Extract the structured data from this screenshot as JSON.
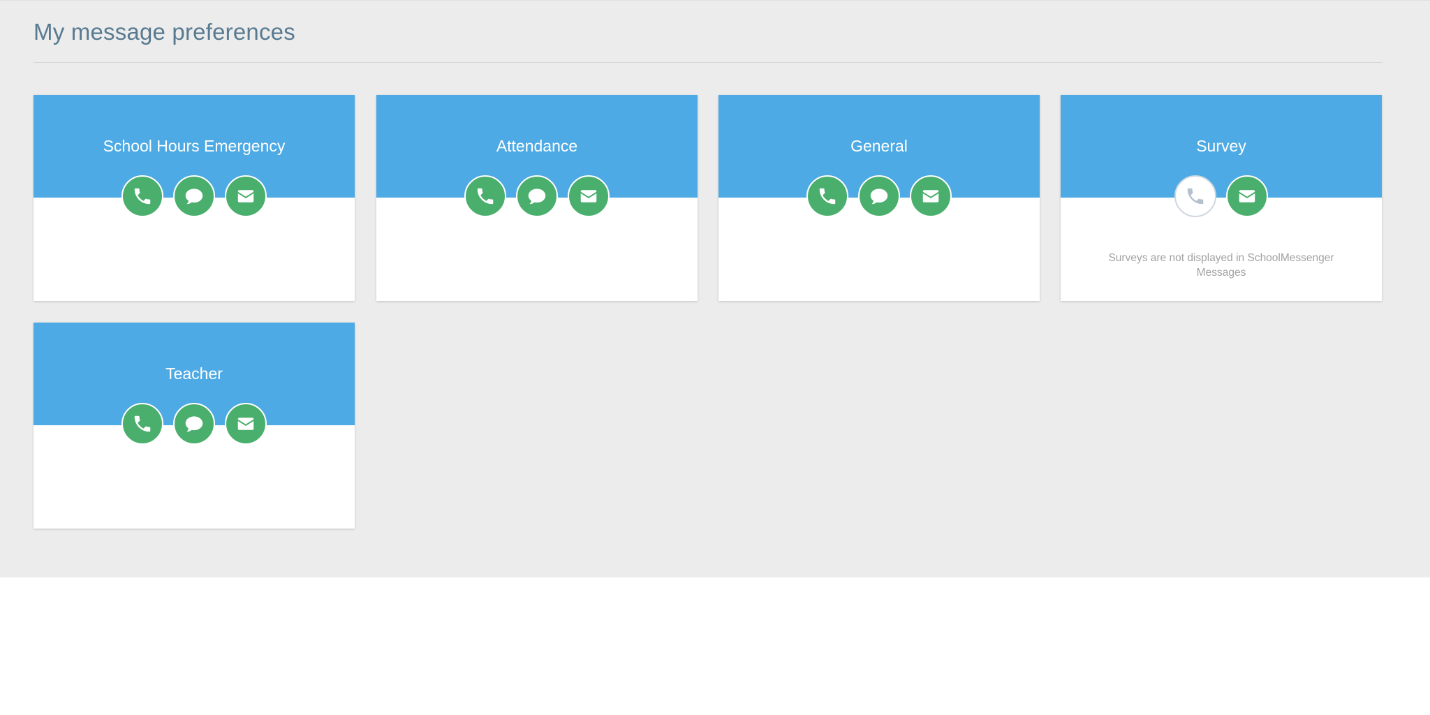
{
  "page": {
    "title": "My message preferences"
  },
  "colors": {
    "panel_background": "#ececec",
    "card_header": "#4eaae4",
    "icon_enabled": "#4aaf6c",
    "icon_disabled_border": "#cfd7e0",
    "title_text": "#587a91",
    "note_text": "#a2a2a2"
  },
  "cards": [
    {
      "title": "School Hours Emergency",
      "channels": [
        {
          "icon": "phone-icon",
          "enabled": true
        },
        {
          "icon": "sms-chat-icon",
          "enabled": true
        },
        {
          "icon": "email-icon",
          "enabled": true
        }
      ],
      "note": ""
    },
    {
      "title": "Attendance",
      "channels": [
        {
          "icon": "phone-icon",
          "enabled": true
        },
        {
          "icon": "sms-chat-icon",
          "enabled": true
        },
        {
          "icon": "email-icon",
          "enabled": true
        }
      ],
      "note": ""
    },
    {
      "title": "General",
      "channels": [
        {
          "icon": "phone-icon",
          "enabled": true
        },
        {
          "icon": "sms-chat-icon",
          "enabled": true
        },
        {
          "icon": "email-icon",
          "enabled": true
        }
      ],
      "note": ""
    },
    {
      "title": "Survey",
      "channels": [
        {
          "icon": "phone-icon",
          "enabled": false
        },
        {
          "icon": "email-icon",
          "enabled": true
        }
      ],
      "note": "Surveys are not displayed in SchoolMessenger Messages"
    },
    {
      "title": "Teacher",
      "channels": [
        {
          "icon": "phone-icon",
          "enabled": true
        },
        {
          "icon": "sms-chat-icon",
          "enabled": true
        },
        {
          "icon": "email-icon",
          "enabled": true
        }
      ],
      "note": ""
    }
  ]
}
